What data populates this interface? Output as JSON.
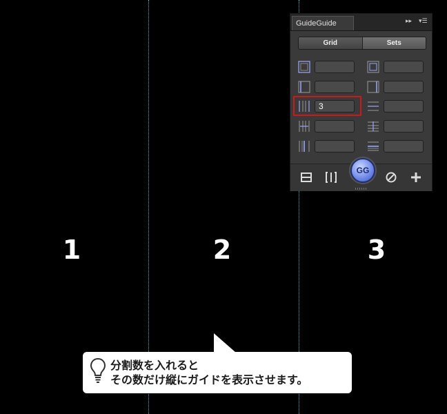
{
  "columns": [
    "1",
    "2",
    "3"
  ],
  "panel": {
    "tab_title": "GuideGuide",
    "segments": {
      "grid_label": "Grid",
      "sets_label": "Sets"
    },
    "column_count_value": "3",
    "logo_label": "GG"
  },
  "callout": {
    "line1": "分割数を入れると",
    "line2": "その数だけ縦にガイドを表示させます。"
  },
  "colors": {
    "guide": "#38c3d6",
    "highlight": "#d01818",
    "accent": "#6d86e8"
  }
}
